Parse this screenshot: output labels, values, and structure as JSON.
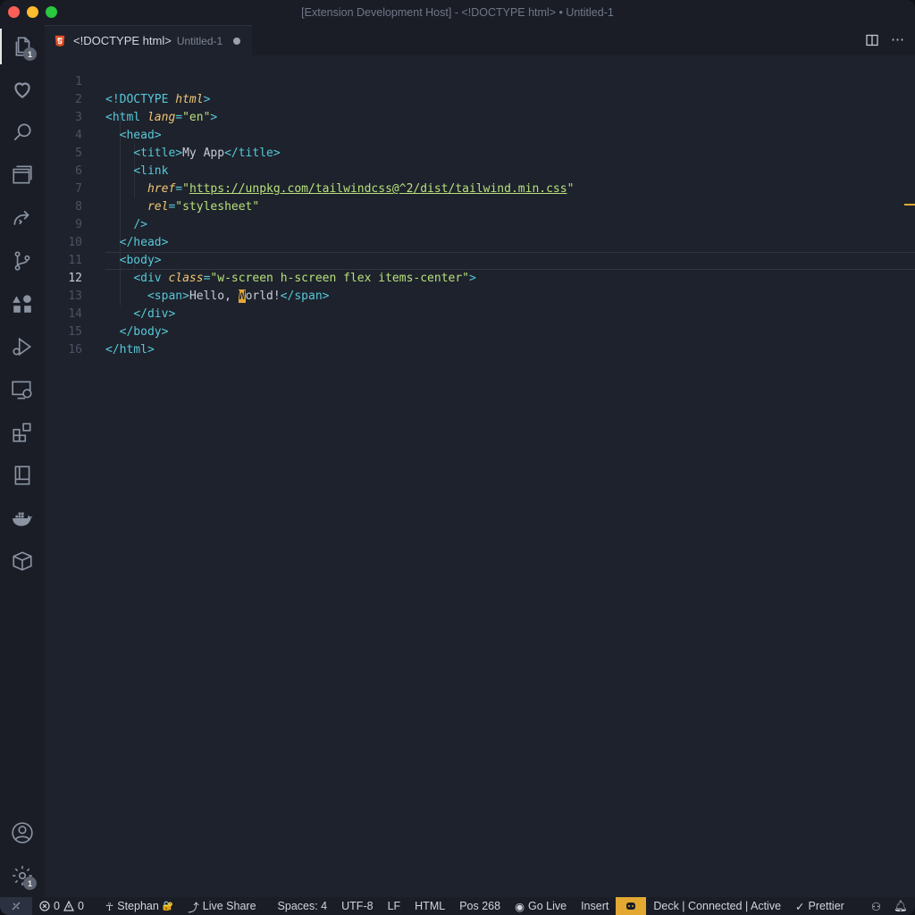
{
  "window": {
    "title": "[Extension Development Host] - <!DOCTYPE html> • Untitled-1"
  },
  "activity_bar": {
    "items": [
      {
        "name": "explorer-icon",
        "badge": "1"
      },
      {
        "name": "heart-icon"
      },
      {
        "name": "search-icon"
      },
      {
        "name": "panels-icon"
      },
      {
        "name": "live-share-icon"
      },
      {
        "name": "source-control-icon"
      },
      {
        "name": "extensions-shapes-icon"
      },
      {
        "name": "run-debug-icon"
      },
      {
        "name": "remote-explorer-icon"
      },
      {
        "name": "extensions-icon"
      },
      {
        "name": "book-icon"
      },
      {
        "name": "docker-icon"
      },
      {
        "name": "package-icon"
      }
    ],
    "accounts": {
      "name": "account-icon"
    },
    "manage": {
      "name": "gear-icon",
      "badge": "1"
    }
  },
  "tab": {
    "name": "<!DOCTYPE html>",
    "description": "Untitled-1"
  },
  "editor": {
    "line_numbers": [
      "1",
      "2",
      "3",
      "4",
      "5",
      "6",
      "7",
      "8",
      "9",
      "10",
      "11",
      "12",
      "13",
      "14",
      "15",
      "16"
    ],
    "current_line": "12",
    "code": {
      "l1_open": "<!DOCTYPE",
      "l1_attr": "html",
      "l1_close": ">",
      "l2_open": "<html",
      "l2_attr": "lang",
      "l2_eq": "=",
      "l2_val": "\"en\"",
      "l2_close": ">",
      "l3": "<head>",
      "l4_open": "<title>",
      "l4_text": "My App",
      "l4_close": "</title>",
      "l5": "<link",
      "l6_attr": "href",
      "l6_eq": "=",
      "l6_q1": "\"",
      "l6_url": "https://unpkg.com/tailwindcss@^2/dist/tailwind.min.css",
      "l6_q2": "\"",
      "l7_attr": "rel",
      "l7_eq": "=",
      "l7_val": "\"stylesheet\"",
      "l8": "/>",
      "l9": "</head>",
      "l10": "<body>",
      "l11_open": "<div",
      "l11_attr": "class",
      "l11_eq": "=",
      "l11_val": "\"w-screen h-screen flex items-center\"",
      "l11_close": ">",
      "l12_open": "<span>",
      "l12_text1": "Hello, ",
      "l12_cursor": "W",
      "l12_text2": "orld!",
      "l12_close": "</span>",
      "l13": "</div>",
      "l14": "</body>",
      "l15": "</html>"
    }
  },
  "status_bar": {
    "errors": "0",
    "warnings": "0",
    "user": "Stephan",
    "live_share": "Live Share",
    "spaces": "Spaces: 4",
    "encoding": "UTF-8",
    "eol": "LF",
    "language": "HTML",
    "position": "Pos 268",
    "go_live": "Go Live",
    "mode": "Insert",
    "deck": "Deck | Connected | Active",
    "prettier": "Prettier"
  },
  "colors": {
    "accent": "#e2a832",
    "tag": "#56c8d8",
    "attr": "#f0c674",
    "string": "#b7e07c"
  }
}
